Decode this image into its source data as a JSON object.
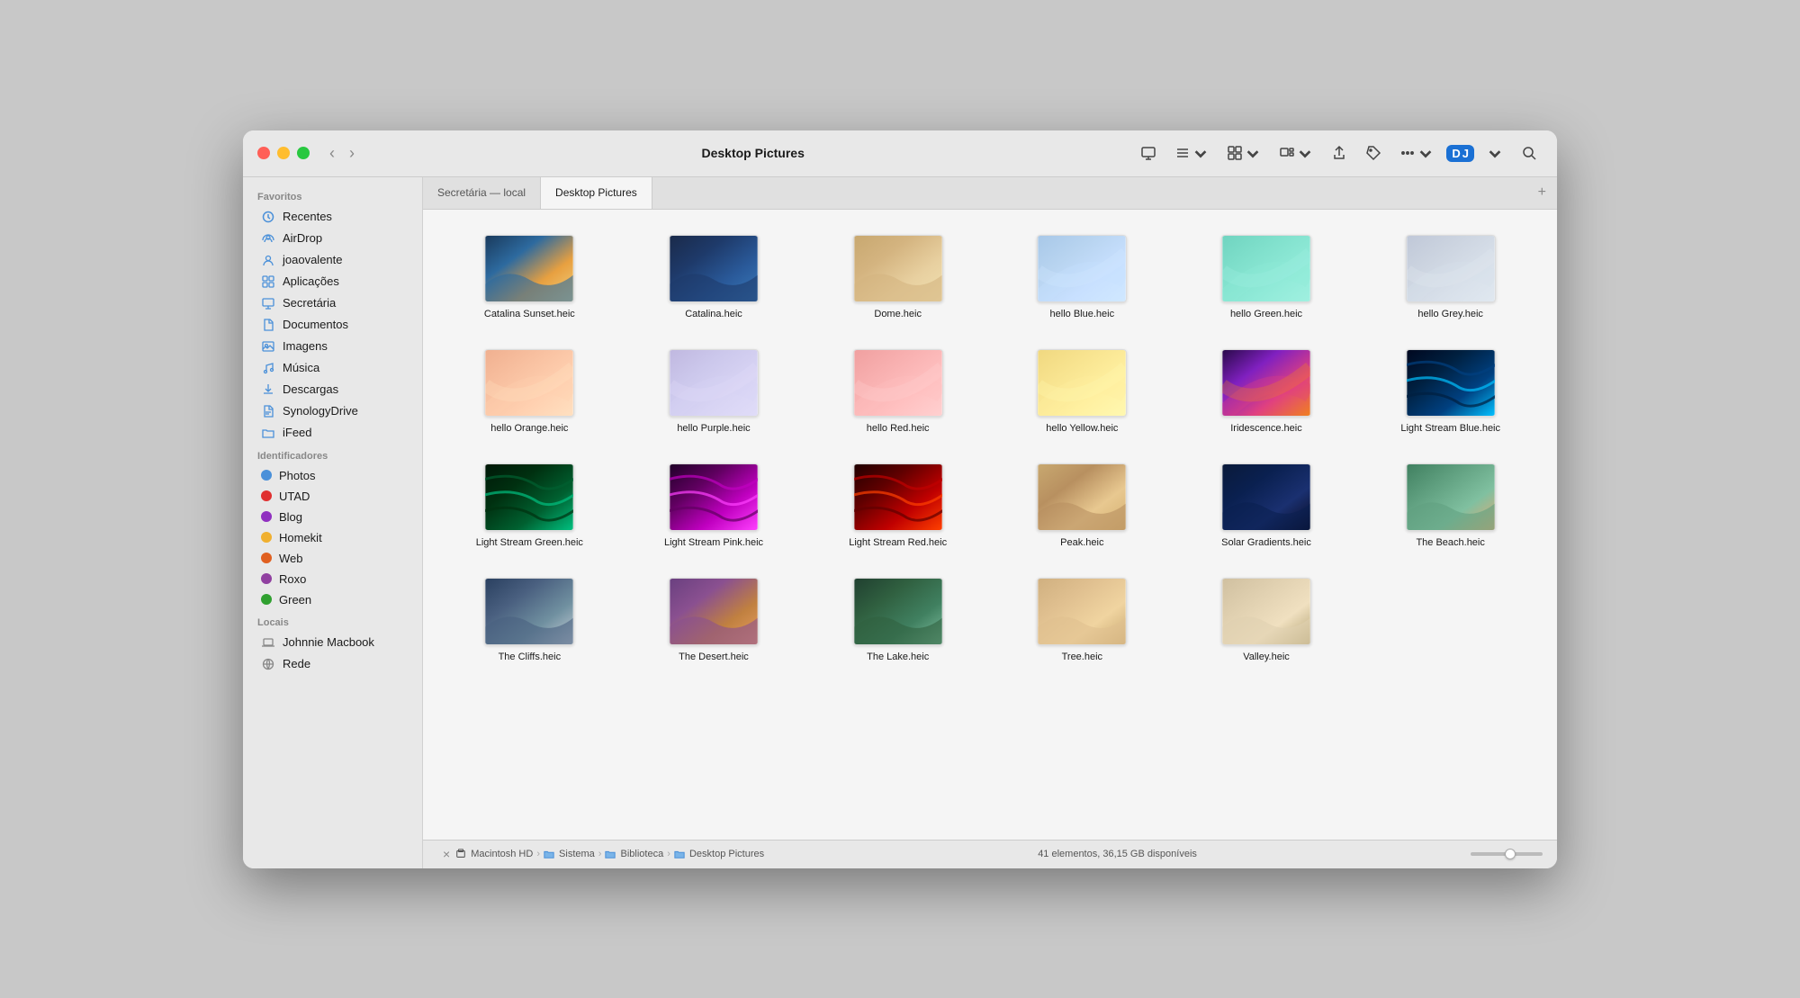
{
  "window": {
    "title": "Desktop Pictures",
    "traffic_lights": [
      "close",
      "minimize",
      "maximize"
    ]
  },
  "toolbar": {
    "back_label": "‹",
    "forward_label": "›",
    "monitor_icon": "monitor-icon",
    "list_icon": "list-icon",
    "grid_icon": "grid-icon",
    "gallery_icon": "gallery-icon",
    "share_icon": "share-icon",
    "tag_icon": "tag-icon",
    "more_icon": "more-icon",
    "app_icon": "app-icon",
    "search_icon": "search-icon"
  },
  "tabs": [
    {
      "label": "Secretária — local",
      "active": false
    },
    {
      "label": "Desktop Pictures",
      "active": true
    }
  ],
  "sidebar": {
    "sections": [
      {
        "label": "Favoritos",
        "items": [
          {
            "id": "recentes",
            "label": "Recentes",
            "icon_type": "clock",
            "color": "#4a90d9"
          },
          {
            "id": "airdrop",
            "label": "AirDrop",
            "icon_type": "airdrop",
            "color": "#4a90d9"
          },
          {
            "id": "joaovalente",
            "label": "joaovalente",
            "icon_type": "person",
            "color": "#4a90d9"
          },
          {
            "id": "aplicacoes",
            "label": "Aplicações",
            "icon_type": "grid",
            "color": "#4a90d9"
          },
          {
            "id": "secretaria",
            "label": "Secretária",
            "icon_type": "monitor",
            "color": "#4a90d9"
          },
          {
            "id": "documentos",
            "label": "Documentos",
            "icon_type": "doc",
            "color": "#4a90d9"
          },
          {
            "id": "imagens",
            "label": "Imagens",
            "icon_type": "photo",
            "color": "#4a90d9"
          },
          {
            "id": "musica",
            "label": "Música",
            "icon_type": "music",
            "color": "#4a90d9"
          },
          {
            "id": "descargas",
            "label": "Descargas",
            "icon_type": "download",
            "color": "#4a90d9"
          },
          {
            "id": "synologydrive",
            "label": "SynologyDrive",
            "icon_type": "doc2",
            "color": "#4a90d9"
          },
          {
            "id": "ifeed",
            "label": "iFeed",
            "icon_type": "folder",
            "color": "#4a90d9"
          }
        ]
      },
      {
        "label": "Identificadores",
        "items": [
          {
            "id": "photos",
            "label": "Photos",
            "icon_type": "dot",
            "color": "#4a90d9"
          },
          {
            "id": "utad",
            "label": "UTAD",
            "icon_type": "dot",
            "color": "#e03030"
          },
          {
            "id": "blog",
            "label": "Blog",
            "icon_type": "dot",
            "color": "#9030c0"
          },
          {
            "id": "homekit",
            "label": "Homekit",
            "icon_type": "dot",
            "color": "#f0b030"
          },
          {
            "id": "web",
            "label": "Web",
            "icon_type": "dot",
            "color": "#e06020"
          },
          {
            "id": "roxo",
            "label": "Roxo",
            "icon_type": "dot",
            "color": "#9040a0"
          },
          {
            "id": "green",
            "label": "Green",
            "icon_type": "dot",
            "color": "#30a030"
          }
        ]
      },
      {
        "label": "Locais",
        "items": [
          {
            "id": "johnniemacbook",
            "label": "Johnnie Macbook",
            "icon_type": "laptop",
            "color": "#888"
          },
          {
            "id": "rede",
            "label": "Rede",
            "icon_type": "network",
            "color": "#888"
          }
        ]
      }
    ]
  },
  "files": [
    {
      "id": "catalina-sunset",
      "name": "Catalina Sunset.heic",
      "thumb_class": "thumb-catalina-sunset"
    },
    {
      "id": "catalina",
      "name": "Catalina.heic",
      "thumb_class": "thumb-catalina"
    },
    {
      "id": "dome",
      "name": "Dome.heic",
      "thumb_class": "thumb-dome"
    },
    {
      "id": "hello-blue",
      "name": "hello Blue.heic",
      "thumb_class": "thumb-hello-blue"
    },
    {
      "id": "hello-green",
      "name": "hello Green.heic",
      "thumb_class": "thumb-hello-green"
    },
    {
      "id": "hello-grey",
      "name": "hello Grey.heic",
      "thumb_class": "thumb-hello-grey"
    },
    {
      "id": "hello-orange",
      "name": "hello Orange.heic",
      "thumb_class": "thumb-hello-orange"
    },
    {
      "id": "hello-purple",
      "name": "hello Purple.heic",
      "thumb_class": "thumb-hello-purple"
    },
    {
      "id": "hello-red",
      "name": "hello Red.heic",
      "thumb_class": "thumb-hello-red"
    },
    {
      "id": "hello-yellow",
      "name": "hello Yellow.heic",
      "thumb_class": "thumb-hello-yellow"
    },
    {
      "id": "iridescence",
      "name": "Iridescence.heic",
      "thumb_class": "thumb-iridescence"
    },
    {
      "id": "light-stream-blue",
      "name": "Light Stream Blue.heic",
      "thumb_class": "thumb-light-stream-blue"
    },
    {
      "id": "light-stream-green",
      "name": "Light Stream Green.heic",
      "thumb_class": "thumb-light-stream-green"
    },
    {
      "id": "light-stream-pink",
      "name": "Light Stream Pink.heic",
      "thumb_class": "thumb-light-stream-pink"
    },
    {
      "id": "light-stream-red",
      "name": "Light Stream Red.heic",
      "thumb_class": "thumb-light-stream-red"
    },
    {
      "id": "peak",
      "name": "Peak.heic",
      "thumb_class": "thumb-peak"
    },
    {
      "id": "solar",
      "name": "Solar Gradients.heic",
      "thumb_class": "thumb-solar"
    },
    {
      "id": "beach",
      "name": "The Beach.heic",
      "thumb_class": "thumb-beach"
    },
    {
      "id": "cliffs",
      "name": "The Cliffs.heic",
      "thumb_class": "thumb-cliffs"
    },
    {
      "id": "desert",
      "name": "The Desert.heic",
      "thumb_class": "thumb-desert"
    },
    {
      "id": "lake",
      "name": "The Lake.heic",
      "thumb_class": "thumb-lake"
    },
    {
      "id": "tree",
      "name": "Tree.heic",
      "thumb_class": "thumb-tree"
    },
    {
      "id": "valley",
      "name": "Valley.heic",
      "thumb_class": "thumb-valley"
    }
  ],
  "status": {
    "text": "41 elementos, 36,15 GB disponíveis",
    "close_label": "×"
  },
  "breadcrumb": {
    "items": [
      "Macintosh HD",
      "Sistema",
      "Biblioteca",
      "Desktop Pictures"
    ]
  }
}
